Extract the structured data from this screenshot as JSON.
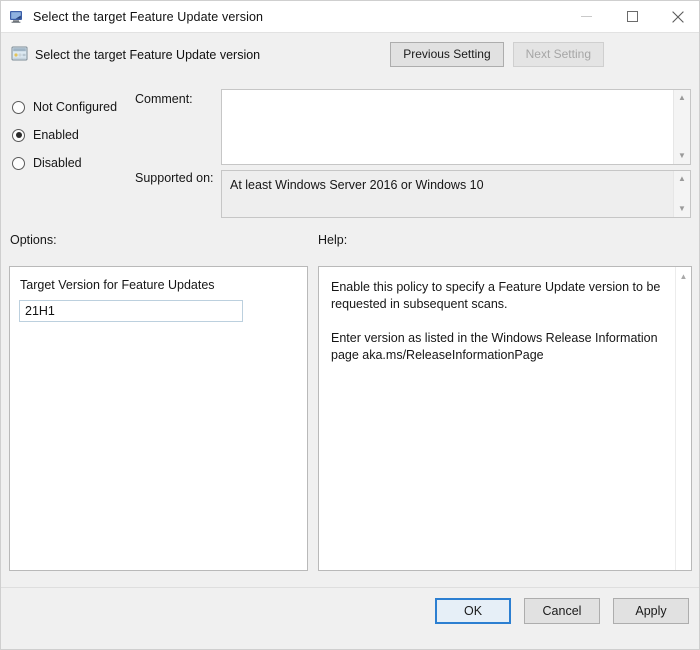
{
  "window": {
    "title": "Select the target Feature Update version",
    "icon": "policy-monitor-icon",
    "controls": {
      "minimize": "–",
      "maximize": "□",
      "close": "✕"
    }
  },
  "header": {
    "icon": "policy-setting-icon",
    "title": "Select the target Feature Update version",
    "previous_setting_label": "Previous Setting",
    "next_setting_label": "Next Setting",
    "next_setting_enabled": false
  },
  "state": {
    "options": [
      {
        "label": "Not Configured",
        "selected": false
      },
      {
        "label": "Enabled",
        "selected": true
      },
      {
        "label": "Disabled",
        "selected": false
      }
    ]
  },
  "comment": {
    "label": "Comment:",
    "value": "",
    "placeholder": ""
  },
  "supported_on": {
    "label": "Supported on:",
    "value": "At least Windows Server 2016 or Windows 10"
  },
  "options_section": {
    "heading": "Options:",
    "field_label": "Target Version for Feature Updates",
    "field_value": "21H1",
    "field_placeholder": ""
  },
  "help_section": {
    "heading": "Help:",
    "text": "Enable this policy to specify a Feature Update version to be requested in subsequent scans.\n\nEnter version as listed in the Windows Release Information page aka.ms/ReleaseInformationPage"
  },
  "footer": {
    "ok_label": "OK",
    "cancel_label": "Cancel",
    "apply_label": "Apply"
  },
  "icons": {
    "scroll_up": "▲",
    "scroll_down": "▼"
  },
  "colors": {
    "dialog_background": "#f0f0f0",
    "panel_background": "#ffffff",
    "accent_focus": "#2c7fd1",
    "input_border": "#bcd0de",
    "readonly_background": "#eeeeee",
    "disabled_text": "#a6a6a6"
  }
}
